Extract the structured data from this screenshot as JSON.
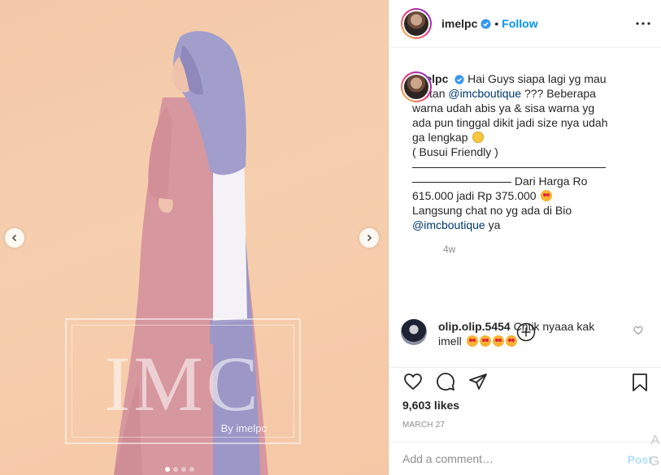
{
  "post": {
    "watermark": {
      "brand": "IMC",
      "byline": "By imelpc"
    },
    "carousel_dots": 4,
    "active_dot": 0
  },
  "header": {
    "username": "imelpc",
    "separator": "•",
    "follow_label": "Follow"
  },
  "caption": {
    "username": "imelpc",
    "lines": [
      "Hai Guys siapa lagi yg mau",
      "Kaftan",
      "warna udah abis ya & sisa warna yg",
      "ada pun tinggal dikit jadi size nya udah",
      "ga lengkap",
      "( Busui Friendly )",
      "Dari Harga Ro",
      "615.000 jadi Rp 375.000",
      "Langsung chat no yg ada di Bio",
      "ya"
    ],
    "mention1": "@imcboutique",
    "after_mention1": " ??? Beberapa",
    "mention2": "@imcboutique",
    "age": "4w"
  },
  "comment": {
    "username": "olip.olip.5454",
    "text_part1": "Cntik nyaaa kak",
    "text_part2": "imell"
  },
  "actions": {
    "likes": "9,603 likes",
    "date": "MARCH 27",
    "comment_placeholder": "Add a comment…",
    "post_label": "Post"
  },
  "edge_text": {
    "top": "A",
    "bottom": "G"
  },
  "colors": {
    "accent": "#0095f6",
    "photo_bg": "#f5c9a9",
    "dress_pink": "#d99aa3",
    "hijab_lavender": "#9e9ac6",
    "post_disabled": "#b2dffc"
  }
}
